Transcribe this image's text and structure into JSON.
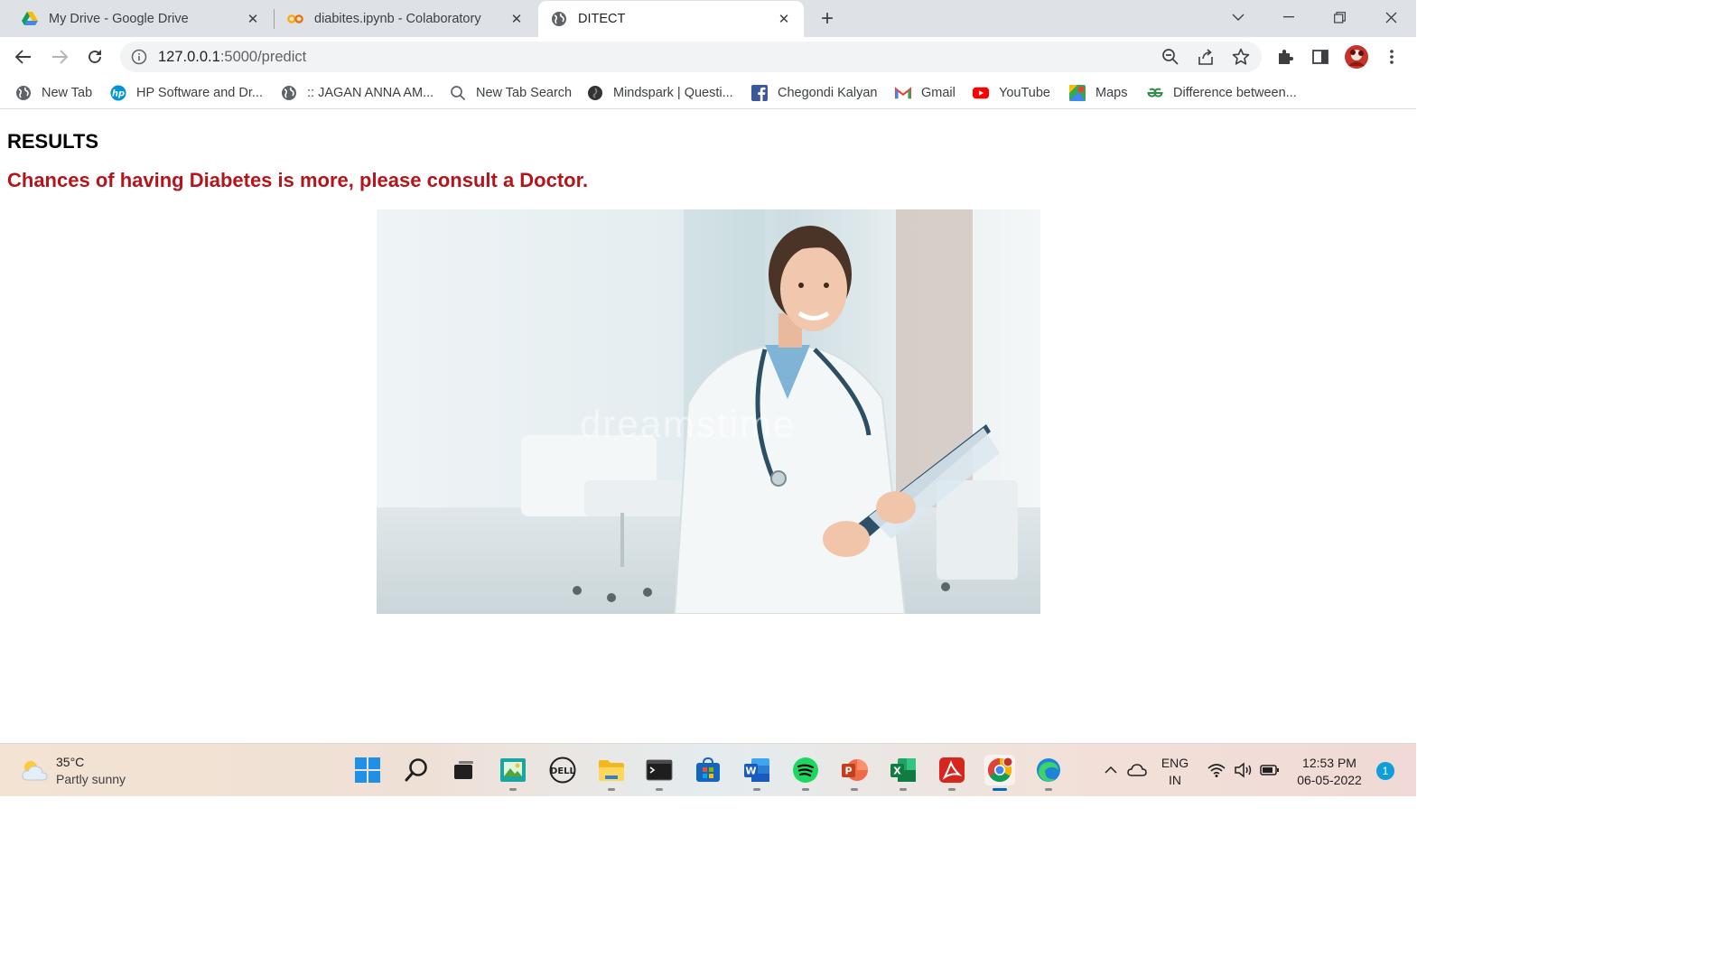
{
  "browser": {
    "tabs": [
      {
        "title": "My Drive - Google Drive",
        "icon": "google-drive-icon"
      },
      {
        "title": "diabites.ipynb - Colaboratory",
        "icon": "colab-icon"
      },
      {
        "title": "DITECT",
        "icon": "globe-icon",
        "active": true
      }
    ],
    "new_tab_symbol": "+",
    "address": {
      "host": "127.0.0.1",
      "path": ":5000/predict"
    },
    "bookmarks": [
      {
        "label": "New Tab",
        "icon": "globe-icon"
      },
      {
        "label": "HP Software and Dr...",
        "icon": "hp-icon"
      },
      {
        "label": ":: JAGAN ANNA AM...",
        "icon": "globe-icon"
      },
      {
        "label": "New Tab Search",
        "icon": "search-icon"
      },
      {
        "label": "Mindspark | Questi...",
        "icon": "mindspark-icon"
      },
      {
        "label": "Chegondi Kalyan",
        "icon": "facebook-icon"
      },
      {
        "label": "Gmail",
        "icon": "gmail-icon"
      },
      {
        "label": "YouTube",
        "icon": "youtube-icon"
      },
      {
        "label": "Maps",
        "icon": "maps-icon"
      },
      {
        "label": "Difference between...",
        "icon": "gfg-icon"
      }
    ]
  },
  "page": {
    "heading": "RESULTS",
    "message": "Chances of having Diabetes is more, please consult a Doctor.",
    "image_watermark": "dreamstime",
    "colors": {
      "message": "#b5141a"
    }
  },
  "taskbar": {
    "weather": {
      "temp": "35°C",
      "desc": "Partly sunny"
    },
    "apps": [
      "windows-start-icon",
      "search-icon",
      "task-view-icon",
      "image-viewer-icon",
      "dell-icon",
      "file-explorer-icon",
      "terminal-icon",
      "microsoft-store-icon",
      "word-icon",
      "spotify-icon",
      "powerpoint-icon",
      "excel-icon",
      "acrobat-icon",
      "chrome-icon",
      "edge-icon"
    ],
    "lang": {
      "line1": "ENG",
      "line2": "IN"
    },
    "clock": {
      "time": "12:53 PM",
      "date": "06-05-2022"
    },
    "notifications": "1"
  }
}
